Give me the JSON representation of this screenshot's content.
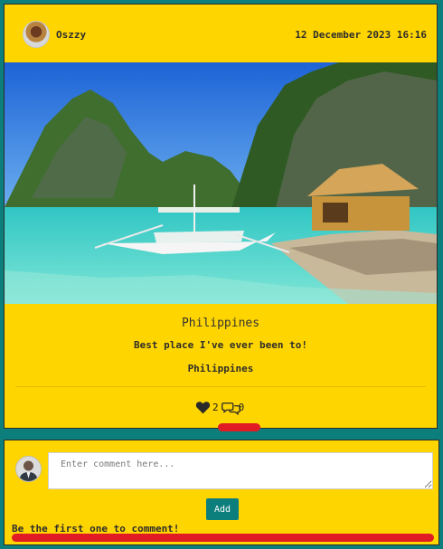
{
  "post": {
    "username": "Oszzy",
    "timestamp": "12 December 2023 16:16",
    "title": "Philippines",
    "caption": "Best place I've ever been to!",
    "location": "Philippines",
    "likes": "2",
    "comments_count": "0",
    "icons": {
      "avatar": "user-avatar",
      "like": "heart-icon",
      "comment": "comments-icon"
    }
  },
  "comment_form": {
    "placeholder": "Enter comment here...",
    "value": "",
    "add_label": "Add",
    "empty_message": "Be the first one to comment!"
  },
  "colors": {
    "card": "#ffd500",
    "background": "#0c7f7c",
    "button": "#0c7f7c",
    "highlight": "#e01b24"
  }
}
